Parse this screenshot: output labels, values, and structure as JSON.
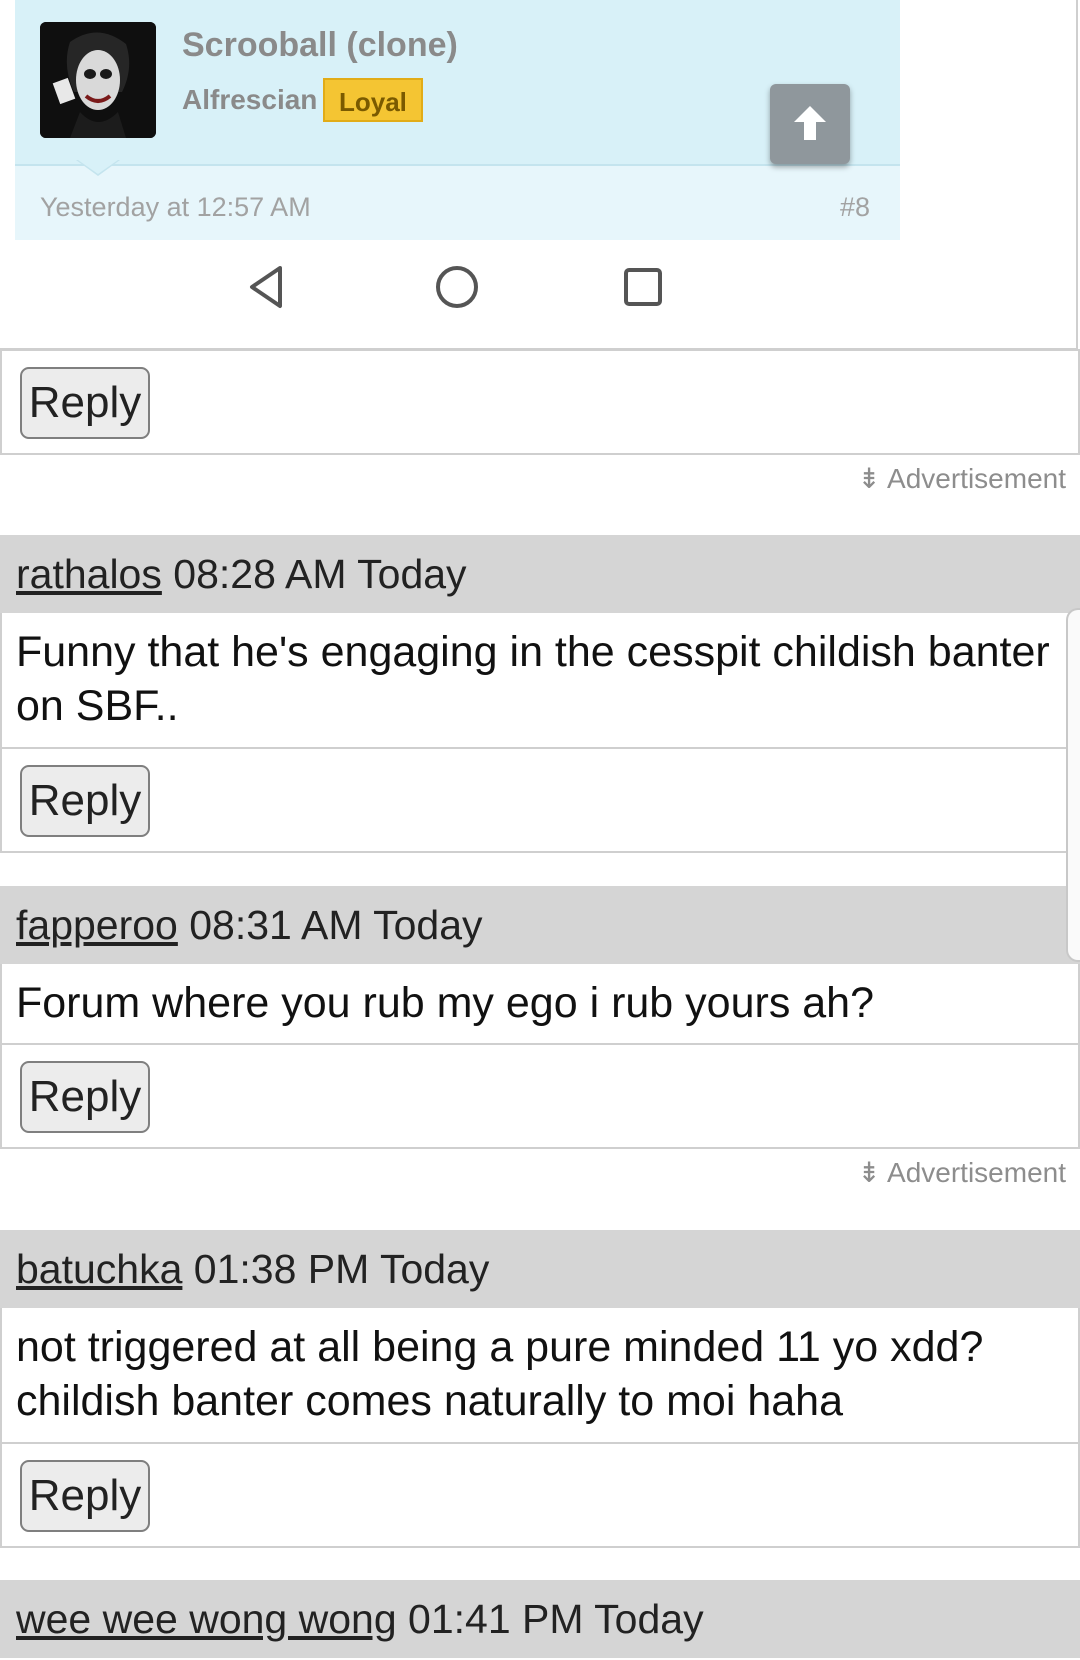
{
  "embedded_post": {
    "username": "Scrooball (clone)",
    "role": "Alfrescian",
    "badge": "Loyal",
    "timestamp": "Yesterday at 12:57 AM",
    "post_number": "#8"
  },
  "reply_label": "Reply",
  "ad_label": "Advertisement",
  "comments": [
    {
      "user": "rathalos",
      "meta": " 08:28 AM Today",
      "body": "Funny that he's engaging in the cesspit childish banter on SBF.."
    },
    {
      "user": "fapperoo",
      "meta": " 08:31 AM Today",
      "body": "Forum where you rub my ego i rub yours ah?"
    },
    {
      "user": "batuchka",
      "meta": " 01:38 PM Today",
      "body": "not triggered at all being a pure minded 11 yo xdd? childish banter comes naturally to moi haha"
    },
    {
      "user": "wee wee wong wong",
      "meta": " 01:41 PM Today",
      "body": ""
    }
  ],
  "colors": {
    "header_gray": "#d5d5d5",
    "badge_yellow": "#f4c533",
    "card_blue": "#d8f1f8"
  }
}
